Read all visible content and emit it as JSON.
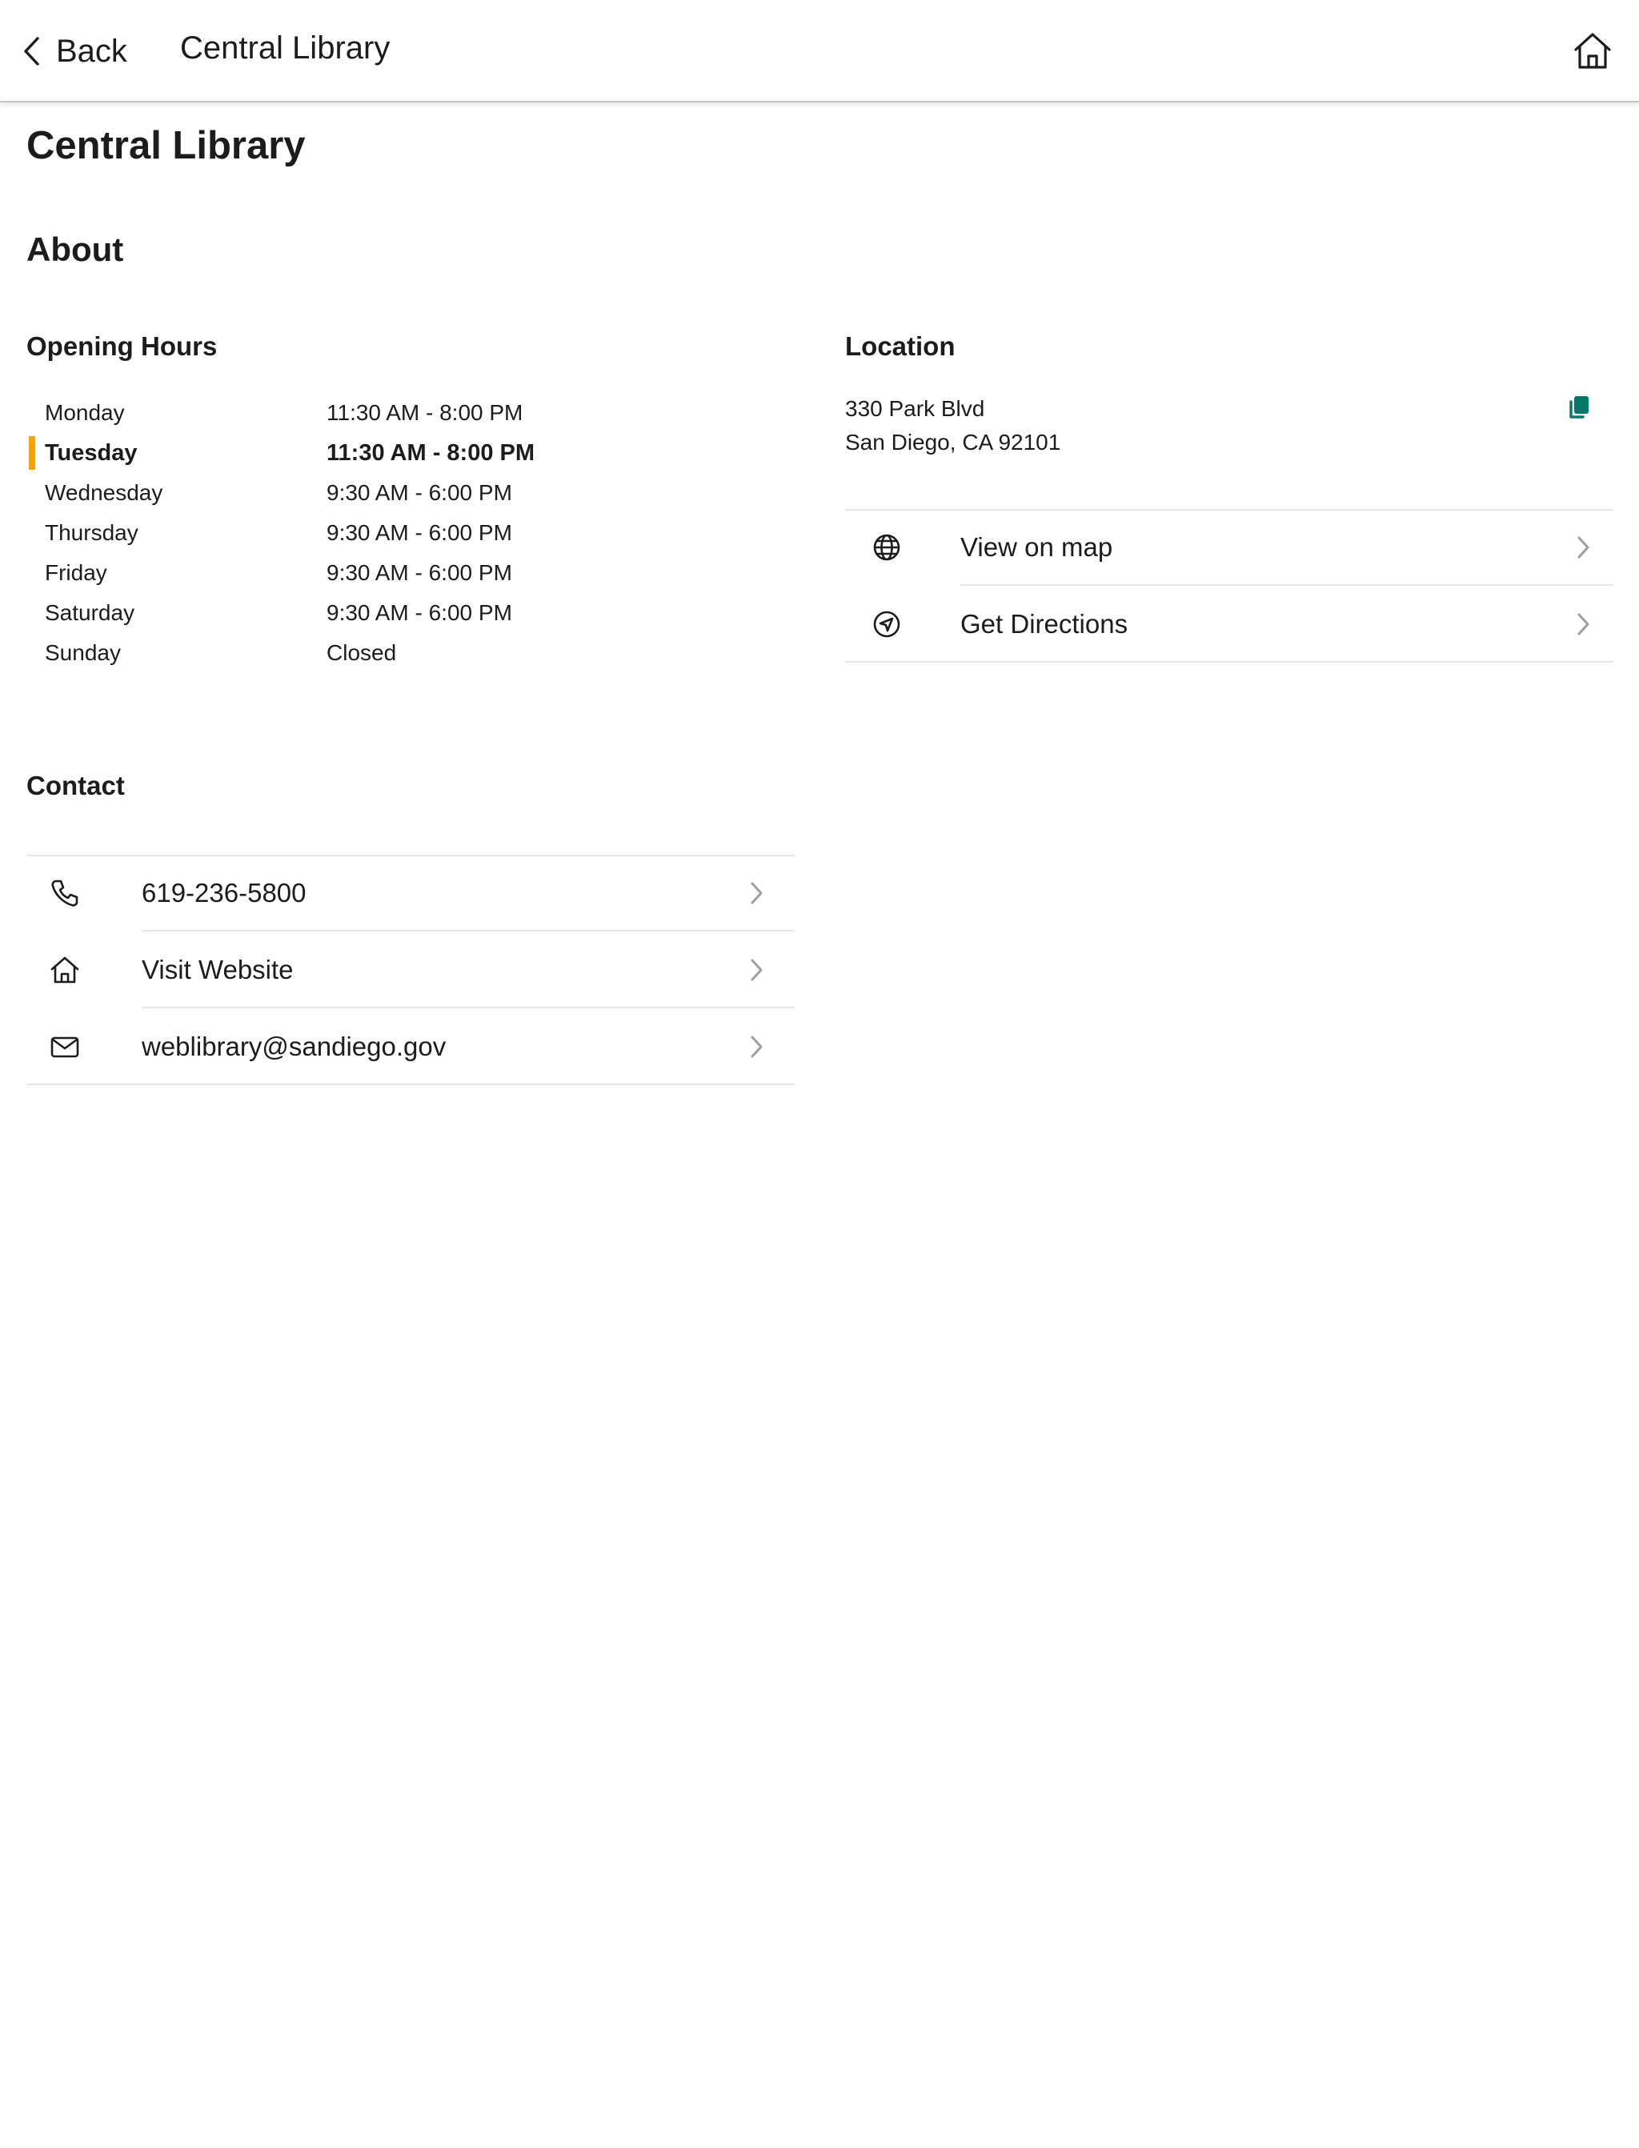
{
  "nav": {
    "back_label": "Back",
    "title": "Central Library",
    "home_icon": "home-icon"
  },
  "page": {
    "title": "Central Library",
    "about_heading": "About"
  },
  "hours": {
    "heading": "Opening Hours",
    "today_marker_color": "#f5a300",
    "rows": [
      {
        "day": "Monday",
        "time": "11:30 AM - 8:00 PM",
        "today": false
      },
      {
        "day": "Tuesday",
        "time": "11:30 AM - 8:00 PM",
        "today": true
      },
      {
        "day": "Wednesday",
        "time": "9:30 AM - 6:00 PM",
        "today": false
      },
      {
        "day": "Thursday",
        "time": "9:30 AM - 6:00 PM",
        "today": false
      },
      {
        "day": "Friday",
        "time": "9:30 AM - 6:00 PM",
        "today": false
      },
      {
        "day": "Saturday",
        "time": "9:30 AM - 6:00 PM",
        "today": false
      },
      {
        "day": "Sunday",
        "time": "Closed",
        "today": false
      }
    ]
  },
  "location": {
    "heading": "Location",
    "address_line1": "330 Park Blvd",
    "address_line2": "San Diego, CA 92101",
    "copy_icon": "copy-icon",
    "copy_icon_color": "#00796b",
    "items": [
      {
        "label": "View on map",
        "icon": "globe-icon"
      },
      {
        "label": "Get Directions",
        "icon": "navigation-icon"
      }
    ]
  },
  "contact": {
    "heading": "Contact",
    "items": [
      {
        "label": "619-236-5800",
        "icon": "phone-icon"
      },
      {
        "label": "Visit Website",
        "icon": "home-icon"
      },
      {
        "label": "weblibrary@sandiego.gov",
        "icon": "mail-icon"
      }
    ]
  }
}
